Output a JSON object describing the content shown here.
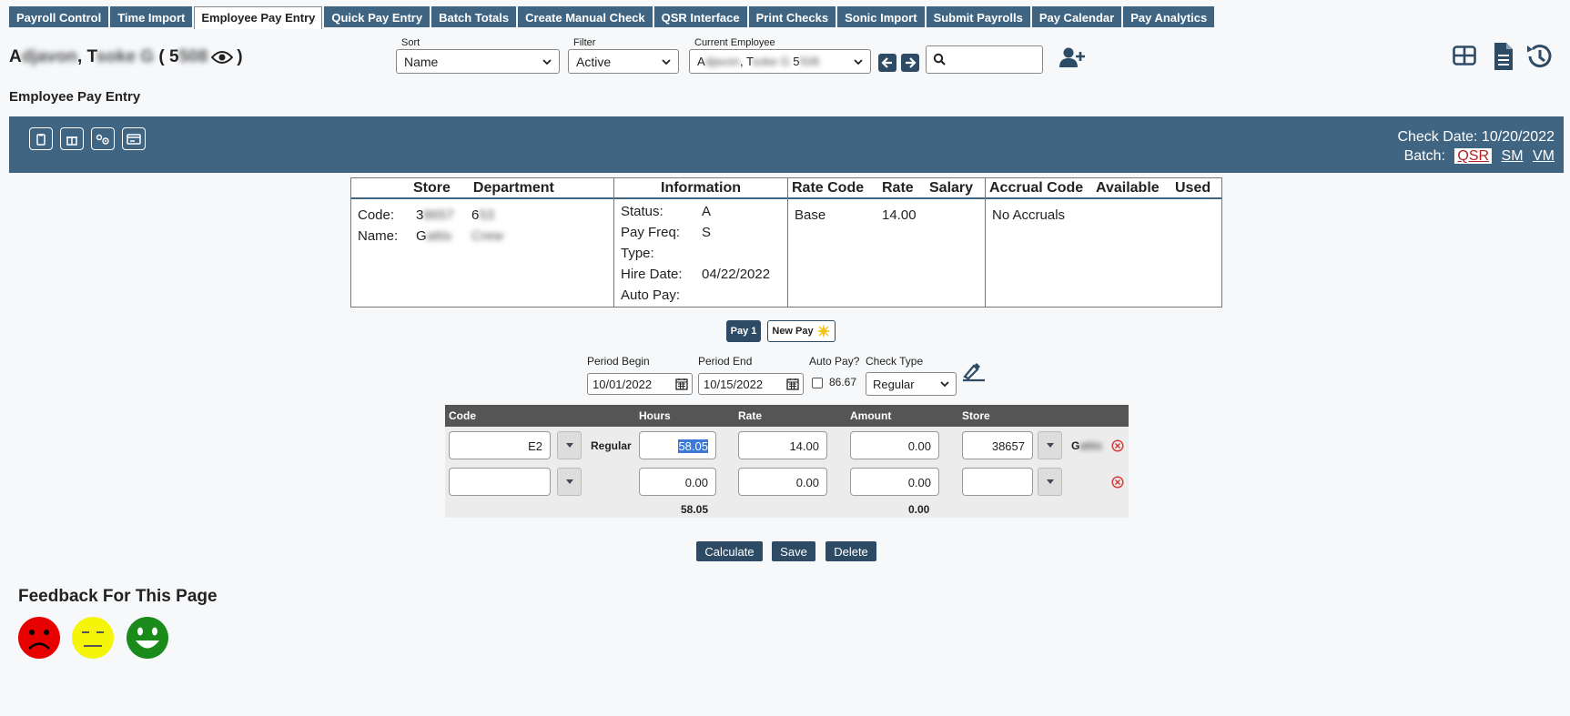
{
  "tabs": [
    {
      "label": "Payroll Control"
    },
    {
      "label": "Time Import"
    },
    {
      "label": "Employee Pay Entry",
      "active": true
    },
    {
      "label": "Quick Pay Entry"
    },
    {
      "label": "Batch Totals"
    },
    {
      "label": "Create Manual Check"
    },
    {
      "label": "QSR Interface"
    },
    {
      "label": "Print Checks"
    },
    {
      "label": "Sonic Import"
    },
    {
      "label": "Submit Payrolls"
    },
    {
      "label": "Pay Calendar"
    },
    {
      "label": "Pay Analytics"
    }
  ],
  "header": {
    "name_prefix": "A",
    "name_blur1": "djavon",
    "name_mid": ", T",
    "name_blur2": "soke G",
    "name_paren": " ( 5",
    "name_blur3": "508",
    "name_close": ")"
  },
  "sort": {
    "label": "Sort",
    "value": "Name"
  },
  "filter": {
    "label": "Filter",
    "value": "Active"
  },
  "current_employee": {
    "label": "Current Employee",
    "v1": "A",
    "v2": "djavon",
    "v3": ", T",
    "v4": "soke G",
    "v5": " 5",
    "v6": "508"
  },
  "page_title": "Employee Pay Entry",
  "check": {
    "date_label": "Check Date: 10/20/2022",
    "batch_label": "Batch:",
    "batches": [
      "QSR",
      "SM",
      "VM"
    ]
  },
  "store_box": {
    "h1": "Store",
    "h2": "Department",
    "code_label": "Code:",
    "code_store": "3",
    "code_store_blur": "8657",
    "code_dept": "6",
    "code_dept_blur": "53",
    "name_label": "Name:",
    "name_store": "G",
    "name_store_blur": "attis",
    "name_dept_blur": "Crew"
  },
  "info_box": {
    "header": "Information",
    "rows": [
      {
        "label": "Status:",
        "value": "A"
      },
      {
        "label": "Pay Freq:",
        "value": "S"
      },
      {
        "label": "Type:",
        "value": ""
      },
      {
        "label": "Hire Date:",
        "value": "04/22/2022"
      },
      {
        "label": "Auto Pay:",
        "value": ""
      }
    ]
  },
  "rate_box": {
    "h1": "Rate Code",
    "h2": "Rate",
    "h3": "Salary",
    "code": "Base",
    "rate": "14.00"
  },
  "accrual_box": {
    "h1": "Accrual Code",
    "h2": "Available",
    "h3": "Used",
    "empty": "No Accruals"
  },
  "pay_tabs": {
    "pay1": "Pay 1",
    "new_pay": "New Pay"
  },
  "period": {
    "begin_label": "Period Begin",
    "begin_value": "10/01/2022",
    "end_label": "Period End",
    "end_value": "10/15/2022",
    "auto_pay_label": "Auto Pay?",
    "auto_pay_amount": "86.67",
    "check_type_label": "Check Type",
    "check_type_value": "Regular"
  },
  "grid": {
    "headers": {
      "code": "Code",
      "hours": "Hours",
      "rate": "Rate",
      "amount": "Amount",
      "store": "Store"
    },
    "row1": {
      "code": "E2",
      "desc": "Regular",
      "hours": "58.05",
      "rate": "14.00",
      "amount": "0.00",
      "store": "38657",
      "store_name": "G",
      "store_name_blur": "attis"
    },
    "row2": {
      "code": "",
      "hours": "0.00",
      "rate": "0.00",
      "amount": "0.00",
      "store": ""
    },
    "totals": {
      "hours": "58.05",
      "amount": "0.00"
    }
  },
  "actions": {
    "calculate": "Calculate",
    "save": "Save",
    "delete": "Delete"
  },
  "feedback": {
    "title": "Feedback For This Page"
  }
}
